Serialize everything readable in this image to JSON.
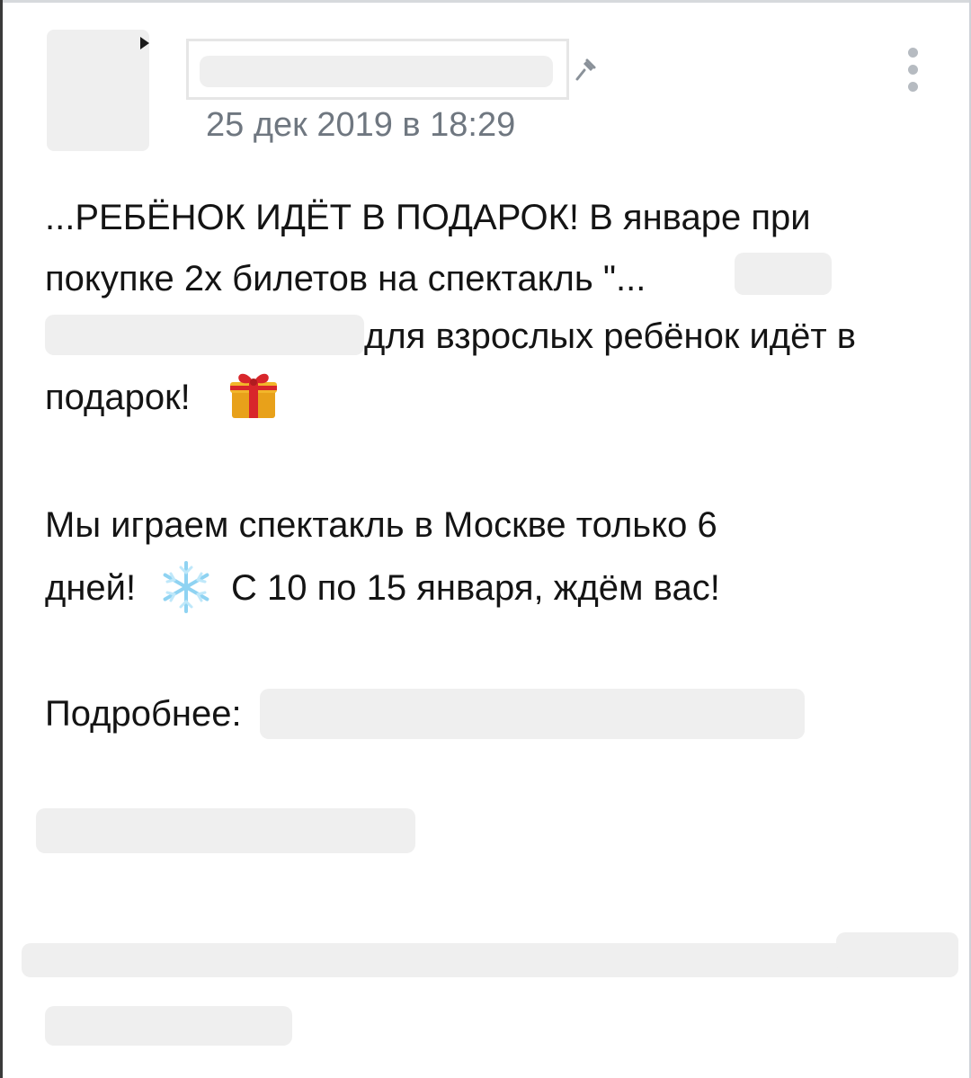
{
  "post": {
    "date": "25 дек 2019 в 18:29",
    "body": {
      "line1": "...РЕБЁНОК ИДЁТ В ПОДАРОК! В январе при",
      "line2": "покупке 2х билетов на спектакль \"...",
      "line3": "для взрослых ребёнок идёт в",
      "line4": "подарок!",
      "line5": "Мы играем спектакль в Москве только 6",
      "line6": "дней!",
      "line6b": "С 10 по 15 января, ждём вас!",
      "line7": "Подробнее:"
    }
  },
  "icons": {
    "menu": "more-vertical-icon",
    "pin": "pin-icon",
    "gift": "gift-emoji",
    "snowflake": "snowflake-emoji"
  },
  "colors": {
    "text": "#141414",
    "date": "#6f7780",
    "link": "#2a5885",
    "redaction": "#efefef"
  }
}
